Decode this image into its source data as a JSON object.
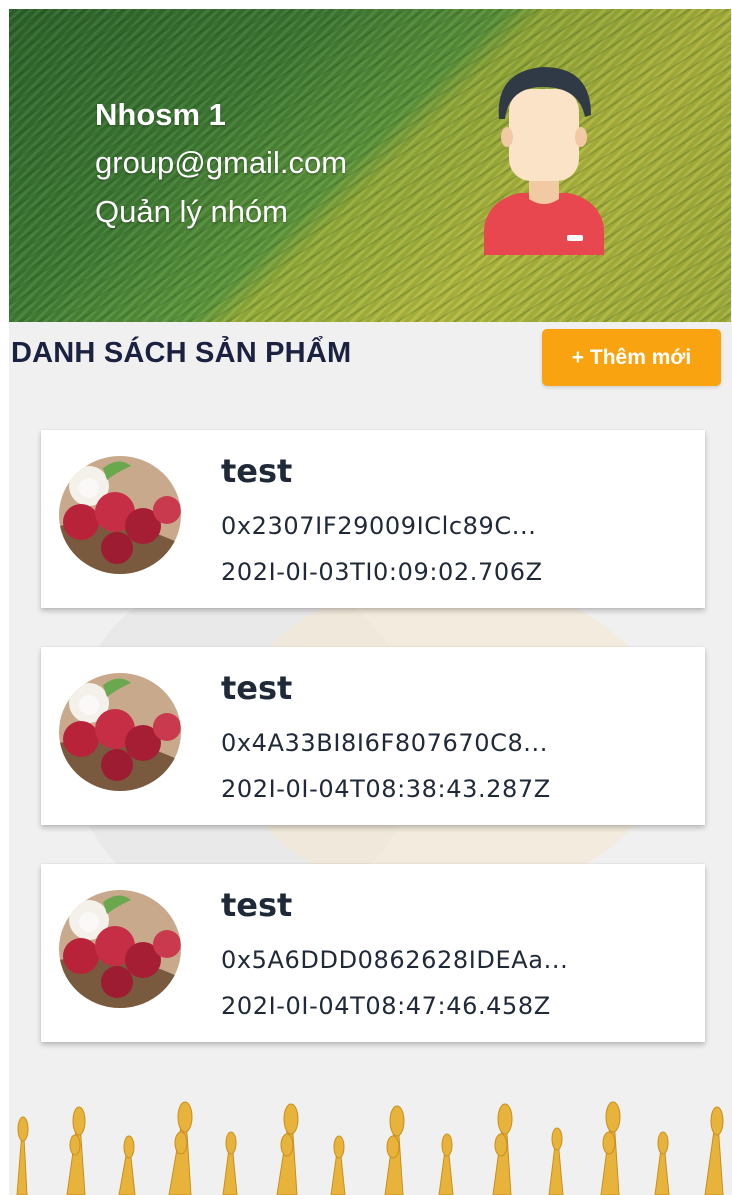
{
  "header": {
    "name": "Nhosm 1",
    "email": "group@gmail.com",
    "role": "Quản lý nhóm"
  },
  "section": {
    "title": "DANH SÁCH SẢN PHẨM",
    "add_button": "+ Thêm mới"
  },
  "products": [
    {
      "title": "test",
      "id": "0x2307IF29009IClc89C...",
      "date": "202I-0I-03TI0:09:02.706Z"
    },
    {
      "title": "test",
      "id": "0x4A33BI8I6F807670C8...",
      "date": "202I-0I-04T08:38:43.287Z"
    },
    {
      "title": "test",
      "id": "0x5A6DDD0862628IDEAa...",
      "date": "202I-0I-04T08:47:46.458Z"
    }
  ],
  "colors": {
    "accent": "#f8a30f",
    "title_text": "#1b2140",
    "avatar_shirt": "#e9474f"
  }
}
